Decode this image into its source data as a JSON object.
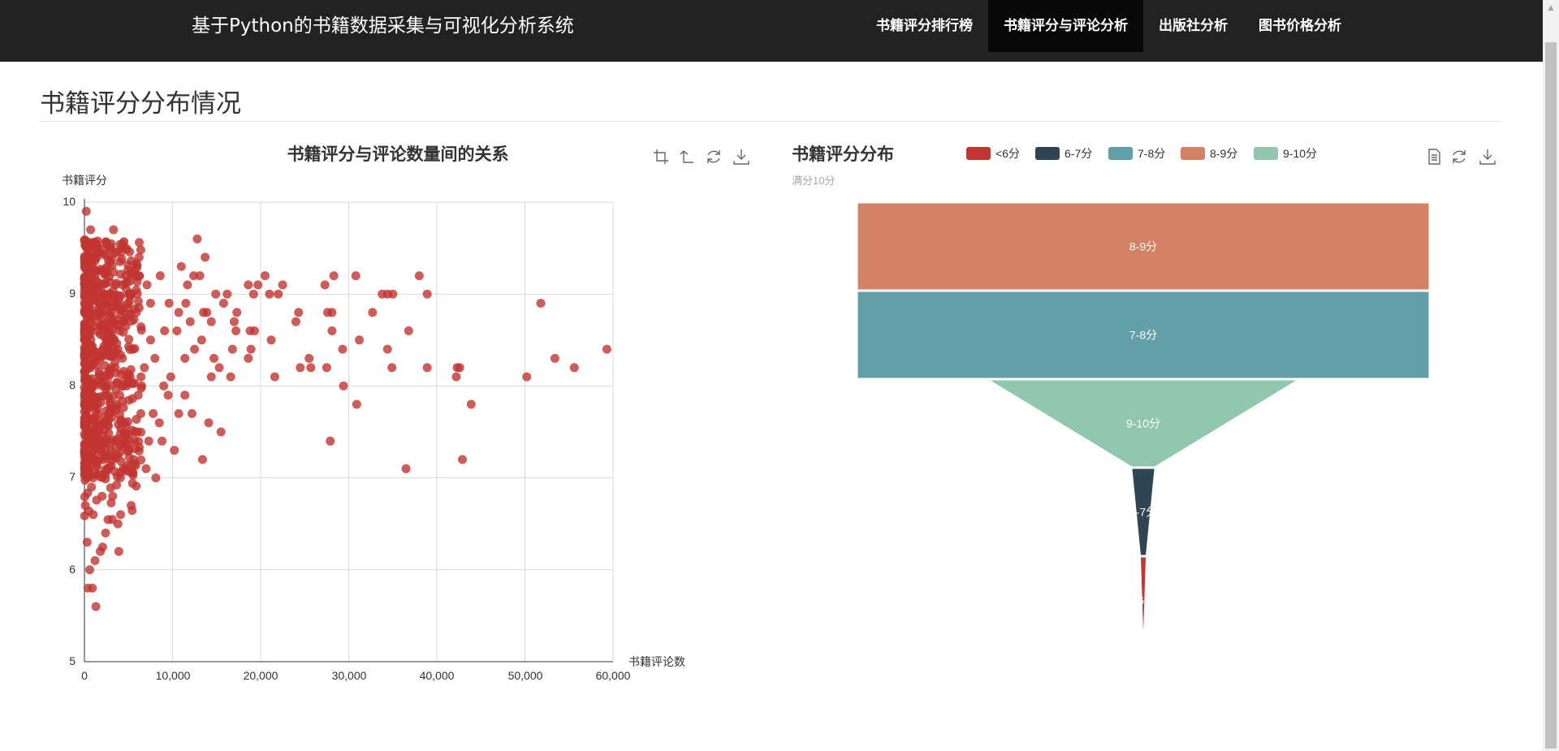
{
  "header": {
    "brand": "基于Python的书籍数据采集与可视化分析系统",
    "nav": [
      {
        "label": "书籍评分排行榜",
        "active": false
      },
      {
        "label": "书籍评分与评论分析",
        "active": true
      },
      {
        "label": "出版社分析",
        "active": false
      },
      {
        "label": "图书价格分析",
        "active": false
      }
    ]
  },
  "page": {
    "title": "书籍评分分布情况"
  },
  "chart_data": [
    {
      "type": "scatter",
      "title": "书籍评分与评论数量间的关系",
      "xlabel": "书籍评论数",
      "ylabel": "书籍评分",
      "xlim": [
        0,
        60000
      ],
      "ylim": [
        5,
        10
      ],
      "xticks": [
        "0",
        "10,000",
        "20,000",
        "30,000",
        "40,000",
        "50,000",
        "60,000"
      ],
      "yticks": [
        "5",
        "6",
        "7",
        "8",
        "9",
        "10"
      ],
      "grid": true,
      "color": "#c23531",
      "toolbox": [
        "zoom-icon",
        "zoom-reset-icon",
        "restore-icon",
        "download-icon"
      ],
      "points": [
        [
          51800,
          8.9
        ],
        [
          59300,
          8.4
        ],
        [
          55600,
          8.2
        ],
        [
          53400,
          8.3
        ],
        [
          50200,
          8.1
        ],
        [
          43900,
          7.8
        ],
        [
          42900,
          7.2
        ],
        [
          42600,
          8.2
        ],
        [
          42200,
          8.1
        ],
        [
          42300,
          8.2
        ],
        [
          38900,
          9.0
        ],
        [
          38900,
          8.2
        ],
        [
          38000,
          9.2
        ],
        [
          36800,
          8.6
        ],
        [
          36500,
          7.1
        ],
        [
          35000,
          9.0
        ],
        [
          34900,
          8.2
        ],
        [
          34400,
          9.0
        ],
        [
          34400,
          8.4
        ],
        [
          33800,
          9.0
        ],
        [
          32700,
          8.8
        ],
        [
          31200,
          8.5
        ],
        [
          30900,
          7.8
        ],
        [
          30800,
          9.2
        ],
        [
          29400,
          8.0
        ],
        [
          29300,
          8.4
        ],
        [
          28300,
          9.2
        ],
        [
          28100,
          8.8
        ],
        [
          28100,
          8.6
        ],
        [
          27900,
          7.4
        ],
        [
          27600,
          8.8
        ],
        [
          27500,
          8.2
        ],
        [
          27300,
          9.1
        ],
        [
          25700,
          8.2
        ],
        [
          25500,
          8.3
        ],
        [
          24500,
          8.2
        ],
        [
          24000,
          8.7
        ],
        [
          22500,
          9.1
        ],
        [
          22000,
          9.0
        ],
        [
          21600,
          8.1
        ],
        [
          21200,
          8.5
        ],
        [
          21000,
          9.0
        ],
        [
          20500,
          9.2
        ],
        [
          19700,
          9.1
        ],
        [
          19300,
          8.6
        ],
        [
          19200,
          9.0
        ],
        [
          18900,
          8.4
        ],
        [
          18800,
          8.6
        ],
        [
          18600,
          9.1
        ],
        [
          18600,
          8.3
        ],
        [
          17300,
          8.8
        ],
        [
          17200,
          8.6
        ],
        [
          17000,
          8.7
        ],
        [
          16800,
          8.4
        ],
        [
          16200,
          9.0
        ],
        [
          15500,
          7.5
        ],
        [
          15300,
          8.2
        ],
        [
          14900,
          9.0
        ],
        [
          14700,
          8.3
        ],
        [
          14400,
          8.7
        ],
        [
          14400,
          8.1
        ],
        [
          14100,
          7.6
        ],
        [
          13900,
          8.8
        ],
        [
          13700,
          9.4
        ],
        [
          13400,
          7.2
        ],
        [
          13300,
          8.5
        ],
        [
          13100,
          9.2
        ],
        [
          12800,
          9.6
        ],
        [
          12400,
          9.2
        ],
        [
          12200,
          7.7
        ],
        [
          12000,
          8.7
        ],
        [
          11700,
          9.1
        ],
        [
          11400,
          8.3
        ],
        [
          11400,
          7.9
        ],
        [
          11000,
          9.3
        ],
        [
          10700,
          8.8
        ],
        [
          10700,
          7.7
        ],
        [
          10200,
          7.3
        ],
        [
          9800,
          8.1
        ],
        [
          9600,
          8.9
        ],
        [
          9500,
          7.9
        ],
        [
          9100,
          8.6
        ],
        [
          8800,
          7.4
        ],
        [
          8600,
          9.2
        ],
        [
          8500,
          7.6
        ],
        [
          8100,
          7.0
        ],
        [
          7800,
          7.7
        ],
        [
          7500,
          8.5
        ],
        [
          7300,
          7.4
        ],
        [
          7100,
          9.1
        ],
        [
          7000,
          7.1
        ],
        [
          6800,
          8.2
        ],
        [
          6400,
          7.7
        ],
        [
          6200,
          9.4
        ],
        [
          6000,
          7.5
        ],
        [
          5900,
          8.8
        ],
        [
          5300,
          6.7
        ],
        [
          5100,
          9.0
        ],
        [
          5000,
          7.3
        ],
        [
          4800,
          8.0
        ],
        [
          4600,
          7.6
        ],
        [
          4400,
          7.1
        ],
        [
          4200,
          9.5
        ],
        [
          4100,
          6.6
        ],
        [
          4000,
          8.6
        ],
        [
          3900,
          6.2
        ],
        [
          3800,
          6.5
        ],
        [
          3700,
          7.8
        ],
        [
          3500,
          9.1
        ],
        [
          3300,
          9.7
        ],
        [
          3200,
          6.8
        ],
        [
          3000,
          7.3
        ],
        [
          2800,
          8.4
        ],
        [
          2700,
          7.1
        ],
        [
          2600,
          9.3
        ],
        [
          2500,
          8.0
        ],
        [
          2400,
          6.4
        ],
        [
          2300,
          9.5
        ],
        [
          2200,
          7.6
        ],
        [
          2100,
          8.8
        ],
        [
          2000,
          6.8
        ],
        [
          1900,
          7.3
        ],
        [
          1800,
          6.2
        ],
        [
          1700,
          9.1
        ],
        [
          1500,
          7.7
        ],
        [
          1400,
          8.3
        ],
        [
          1300,
          5.6
        ],
        [
          1200,
          6.1
        ],
        [
          1100,
          9.4
        ],
        [
          1000,
          6.6
        ],
        [
          900,
          5.8
        ],
        [
          900,
          8.0
        ],
        [
          800,
          6.9
        ],
        [
          700,
          9.7
        ],
        [
          600,
          6.0
        ],
        [
          500,
          7.4
        ],
        [
          400,
          5.8
        ],
        [
          300,
          6.3
        ],
        [
          200,
          9.9
        ],
        [
          100,
          6.7
        ],
        [
          1000,
          7.0
        ],
        [
          1500,
          7.5
        ],
        [
          2000,
          8.0
        ],
        [
          2500,
          8.5
        ],
        [
          3000,
          9.0
        ],
        [
          3500,
          8.2
        ],
        [
          4000,
          7.9
        ],
        [
          4500,
          8.7
        ],
        [
          5500,
          8.4
        ],
        [
          6500,
          8.0
        ],
        [
          7500,
          8.9
        ],
        [
          8000,
          8.3
        ],
        [
          9000,
          8.0
        ],
        [
          10500,
          8.6
        ],
        [
          11500,
          8.9
        ],
        [
          12500,
          8.4
        ],
        [
          13500,
          8.8
        ],
        [
          15800,
          8.9
        ],
        [
          16600,
          8.1
        ],
        [
          24300,
          8.8
        ],
        [
          600,
          8.6
        ],
        [
          700,
          8.2
        ],
        [
          1600,
          8.9
        ],
        [
          2700,
          8.6
        ],
        [
          3800,
          8.4
        ],
        [
          4700,
          9.2
        ],
        [
          5200,
          8.1
        ],
        [
          6100,
          7.9
        ],
        [
          800,
          9.2
        ],
        [
          1100,
          7.8
        ],
        [
          1300,
          8.7
        ],
        [
          1800,
          8.1
        ],
        [
          2200,
          9.0
        ],
        [
          2900,
          7.7
        ],
        [
          3400,
          8.5
        ],
        [
          3600,
          7.4
        ],
        [
          4300,
          8.3
        ],
        [
          5600,
          7.2
        ],
        [
          300,
          8.4
        ],
        [
          400,
          7.8
        ],
        [
          500,
          9.0
        ],
        [
          200,
          7.2
        ],
        [
          100,
          8.1
        ],
        [
          1700,
          7.2
        ],
        [
          2600,
          7.9
        ],
        [
          3100,
          8.8
        ]
      ]
    },
    {
      "type": "funnel",
      "title": "书籍评分分布",
      "subtitle": "满分10分",
      "legend": [
        "<6分",
        "6-7分",
        "7-8分",
        "8-9分",
        "9-10分"
      ],
      "legend_placement": "top",
      "colors": {
        "<6分": "#c23531",
        "6-7分": "#2f4554",
        "7-8分": "#61a0a8",
        "8-9分": "#d48265",
        "9-10分": "#91c7ae"
      },
      "toolbox": [
        "data-view-icon",
        "restore-icon",
        "download-icon"
      ],
      "order": [
        "8-9分",
        "7-8分",
        "9-10分",
        "6-7分",
        "<6分"
      ],
      "relative_size": {
        "8-9分": 1.0,
        "7-8分": 1.0,
        "9-10分": 0.54,
        "6-7分": 0.04,
        "<6分": 0.01
      }
    }
  ]
}
